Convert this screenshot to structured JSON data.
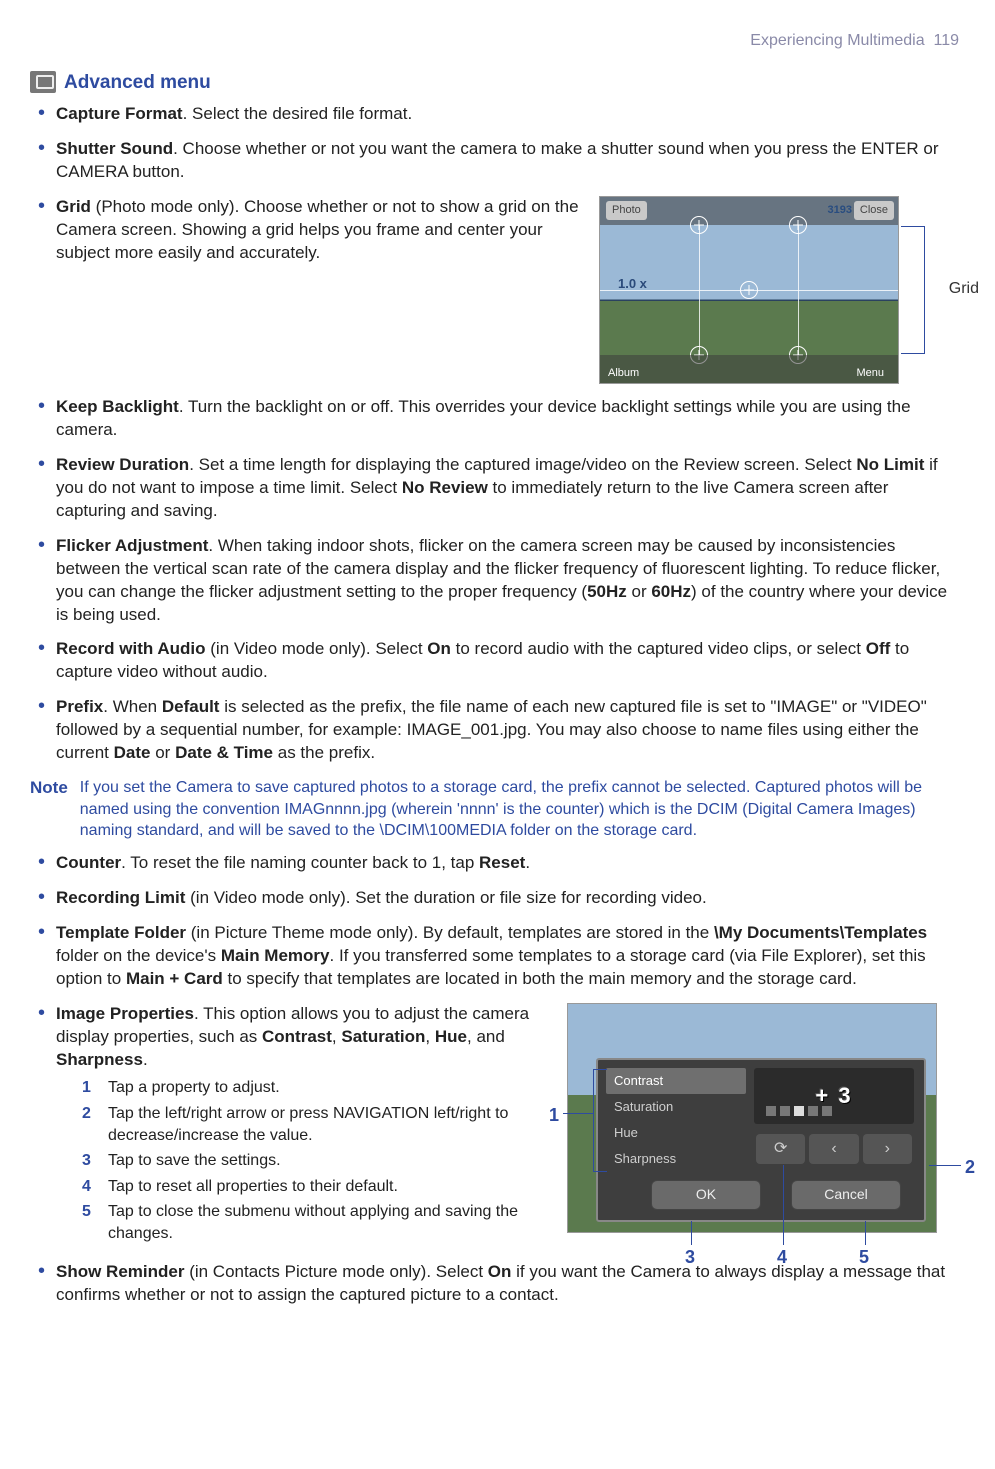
{
  "header": {
    "chapter": "Experiencing Multimedia",
    "page": "119"
  },
  "section": {
    "title": "Advanced menu"
  },
  "items": {
    "capture_format": {
      "t": "Capture Format",
      "d": ". Select the desired file format."
    },
    "shutter_sound": {
      "t": "Shutter Sound",
      "d": ". Choose whether or not you want the camera to make a shutter sound when you press the ENTER or CAMERA button."
    },
    "grid": {
      "t": "Grid",
      "note": " (Photo mode only). ",
      "d": "Choose whether or not to show a grid on the Camera screen. Showing a grid helps you frame and center your subject more easily and accurately."
    },
    "grid_fig": {
      "photo": "Photo",
      "counter": "3193",
      "close": "Close",
      "zoom": "1.0 x",
      "album": "Album",
      "menu": "Menu",
      "label": "Grid"
    },
    "keep_backlight": {
      "t": "Keep Backlight",
      "d": ". Turn the backlight on or off. This overrides your device backlight settings while you are using the camera."
    },
    "review_duration": {
      "t": "Review Duration",
      "d1": ". Set a time length for displaying the captured image/video on the Review screen. Select ",
      "b1": "No Limit",
      "d2": " if you do not want to impose a time limit. Select ",
      "b2": "No Review",
      "d3": "  to immediately return to the live Camera screen after capturing and saving."
    },
    "flicker": {
      "t": "Flicker Adjustment",
      "d1": ". When taking indoor shots, flicker on the camera screen may be caused by inconsistencies between the vertical scan rate of the camera display and the flicker frequency of fluorescent lighting. To reduce flicker, you can change the flicker adjustment setting to the proper frequency (",
      "b1": "50Hz",
      "or": " or ",
      "b2": "60Hz",
      "d2": ") of the country where your device is being used."
    },
    "record_audio": {
      "t": "Record with Audio",
      "note": " (in Video mode only). ",
      "d1": "Select ",
      "b1": "On",
      "d2": " to record audio with the captured video clips, or select ",
      "b2": "Off",
      "d3": " to capture video without audio."
    },
    "prefix": {
      "t": "Prefix",
      "d1": ". When ",
      "b1": "Default",
      "d2": " is selected as the prefix, the file name of each new captured file is set to \"IMAGE\" or \"VIDEO\" followed by a sequential number, for example: IMAGE_001.jpg. You may also choose to name files using either the current ",
      "b2": "Date",
      "or": " or ",
      "b3": "Date & Time",
      "d3": " as the prefix."
    },
    "note": {
      "k": "Note",
      "txt": "If you set the Camera to save captured photos to a storage card, the prefix cannot be selected. Captured photos will be named using the convention IMAGnnnn.jpg (wherein 'nnnn' is the counter) which is the DCIM (Digital Camera Images) naming standard, and will be saved to the \\DCIM\\100MEDIA folder on the storage card."
    },
    "counter": {
      "t": "Counter",
      "d1": ". To reset the file naming counter back to 1, tap ",
      "b1": "Reset",
      "d2": "."
    },
    "rec_limit": {
      "t": "Recording Limit",
      "note": " (in Video mode only). ",
      "d": "Set the duration or file size for recording video."
    },
    "template": {
      "t": "Template Folder",
      "note": " (in Picture Theme mode only). ",
      "d1": "By default, templates are stored in the ",
      "b1": "\\My Documents\\Templates",
      "d2": " folder on the device's ",
      "b2": "Main Memory",
      "d3": ". If you transferred some templates to a storage card (via File Explorer), set this option to ",
      "b3": "Main + Card",
      "d4": " to specify that templates are located in both the main memory and the storage card."
    },
    "image_props": {
      "t": "Image Properties",
      "d1": ". This option allows you to adjust the camera display properties, such as ",
      "b1": "Contrast",
      "c1": ", ",
      "b2": "Saturation",
      "c2": ", ",
      "b3": "Hue",
      "c3": ", and ",
      "b4": "Sharpness",
      "d2": ".",
      "steps": {
        "s1": "Tap a property to adjust.",
        "s2": "Tap the left/right arrow or press NAVIGATION left/right to decrease/increase the value.",
        "s3": "Tap to save the settings.",
        "s4": "Tap to reset all properties to their default.",
        "s5": "Tap to close the submenu without applying and saving the changes."
      },
      "fig": {
        "opts": {
          "contrast": "Contrast",
          "saturation": "Saturation",
          "hue": "Hue",
          "sharpness": "Sharpness"
        },
        "value": "+ 3",
        "ok": "OK",
        "cancel": "Cancel",
        "c1": "1",
        "c2": "2",
        "c3": "3",
        "c4": "4",
        "c5": "5"
      }
    },
    "show_reminder": {
      "t": "Show Reminder",
      "note": " (in Contacts Picture mode only). ",
      "d1": "Select ",
      "b1": "On",
      "d2": " if you want the Camera to always display a message that confirms whether or not to assign the captured picture to a contact."
    }
  }
}
